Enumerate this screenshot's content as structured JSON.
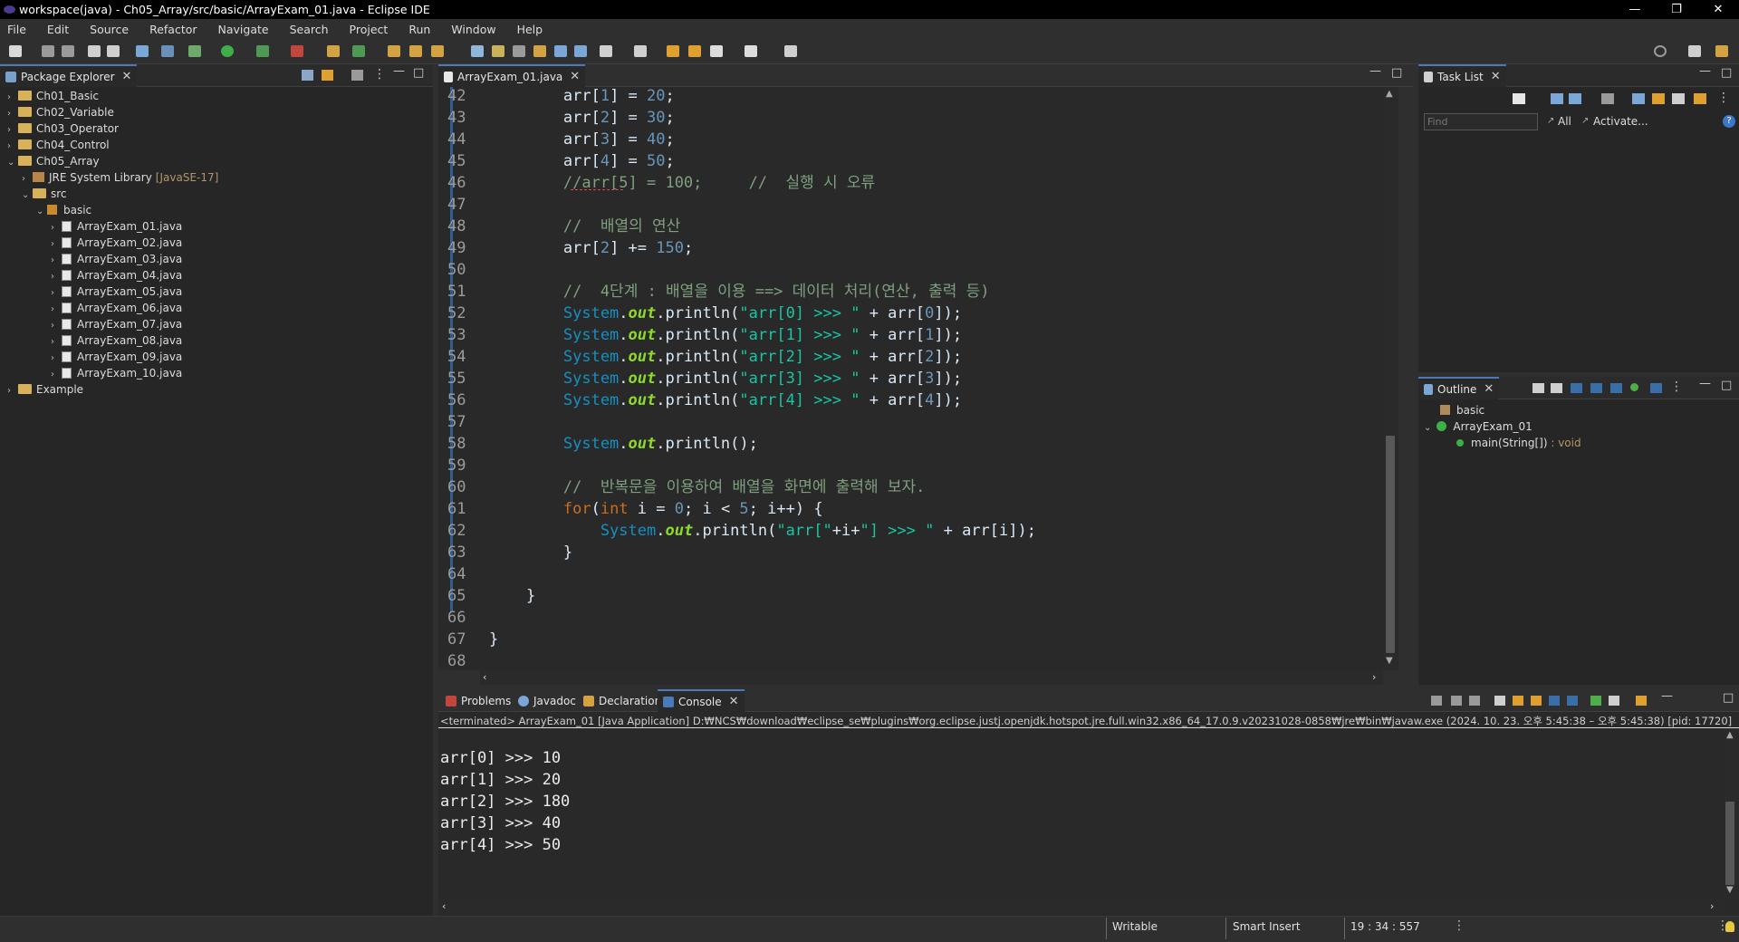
{
  "window": {
    "title": "workspace(java) - Ch05_Array/src/basic/ArrayExam_01.java - Eclipse IDE",
    "controls": [
      "—",
      "❐",
      "✕"
    ]
  },
  "menu": [
    "File",
    "Edit",
    "Source",
    "Refactor",
    "Navigate",
    "Search",
    "Project",
    "Run",
    "Window",
    "Help"
  ],
  "package_explorer": {
    "tab": "Package Explorer",
    "items": [
      {
        "label": "Ch01_Basic",
        "depth": 0,
        "type": "project",
        "chev": "›"
      },
      {
        "label": "Ch02_Variable",
        "depth": 0,
        "type": "project",
        "chev": "›"
      },
      {
        "label": "Ch03_Operator",
        "depth": 0,
        "type": "project",
        "chev": "›"
      },
      {
        "label": "Ch04_Control",
        "depth": 0,
        "type": "project",
        "chev": "›"
      },
      {
        "label": "Ch05_Array",
        "depth": 0,
        "type": "project",
        "chev": "⌄"
      },
      {
        "label": "JRE System Library",
        "suffix": "[JavaSE-17]",
        "depth": 1,
        "type": "lib",
        "chev": "›"
      },
      {
        "label": "src",
        "depth": 1,
        "type": "folder",
        "chev": "⌄"
      },
      {
        "label": "basic",
        "depth": 2,
        "type": "package",
        "chev": "⌄"
      },
      {
        "label": "ArrayExam_01.java",
        "depth": 3,
        "type": "file",
        "chev": "›"
      },
      {
        "label": "ArrayExam_02.java",
        "depth": 3,
        "type": "file",
        "chev": "›"
      },
      {
        "label": "ArrayExam_03.java",
        "depth": 3,
        "type": "file",
        "chev": "›"
      },
      {
        "label": "ArrayExam_04.java",
        "depth": 3,
        "type": "file",
        "chev": "›"
      },
      {
        "label": "ArrayExam_05.java",
        "depth": 3,
        "type": "file",
        "chev": "›"
      },
      {
        "label": "ArrayExam_06.java",
        "depth": 3,
        "type": "file",
        "chev": "›"
      },
      {
        "label": "ArrayExam_07.java",
        "depth": 3,
        "type": "file",
        "chev": "›"
      },
      {
        "label": "ArrayExam_08.java",
        "depth": 3,
        "type": "file",
        "chev": "›"
      },
      {
        "label": "ArrayExam_09.java",
        "depth": 3,
        "type": "file",
        "chev": "›"
      },
      {
        "label": "ArrayExam_10.java",
        "depth": 3,
        "type": "file",
        "chev": "›"
      },
      {
        "label": "Example",
        "depth": 0,
        "type": "project",
        "chev": "›"
      }
    ]
  },
  "editor": {
    "tab": "ArrayExam_01.java",
    "lines": [
      {
        "n": "42",
        "t": [
          [
            "def",
            "        arr["
          ],
          [
            "num",
            "1"
          ],
          [
            "def",
            "] = "
          ],
          [
            "num",
            "20"
          ],
          [
            "def",
            ";"
          ]
        ]
      },
      {
        "n": "43",
        "t": [
          [
            "def",
            "        arr["
          ],
          [
            "num",
            "2"
          ],
          [
            "def",
            "] = "
          ],
          [
            "num",
            "30"
          ],
          [
            "def",
            ";"
          ]
        ]
      },
      {
        "n": "44",
        "t": [
          [
            "def",
            "        arr["
          ],
          [
            "num",
            "3"
          ],
          [
            "def",
            "] = "
          ],
          [
            "num",
            "40"
          ],
          [
            "def",
            ";"
          ]
        ]
      },
      {
        "n": "45",
        "t": [
          [
            "def",
            "        arr["
          ],
          [
            "num",
            "4"
          ],
          [
            "def",
            "] = "
          ],
          [
            "num",
            "50"
          ],
          [
            "def",
            ";"
          ]
        ]
      },
      {
        "n": "46",
        "t": [
          [
            "cmt",
            "        //arr[5] = 100;     //  실행 시 오류"
          ]
        ]
      },
      {
        "n": "47",
        "t": []
      },
      {
        "n": "48",
        "t": [
          [
            "cmt",
            "        //  배열의 연산"
          ]
        ]
      },
      {
        "n": "49",
        "t": [
          [
            "def",
            "        arr["
          ],
          [
            "num",
            "2"
          ],
          [
            "def",
            "] += "
          ],
          [
            "num",
            "150"
          ],
          [
            "def",
            ";"
          ]
        ]
      },
      {
        "n": "50",
        "t": []
      },
      {
        "n": "51",
        "t": [
          [
            "cmt",
            "        //  4단계 : 배열을 이용 ==> 데이터 처리(연산, 출력 등)"
          ]
        ]
      },
      {
        "n": "52",
        "t": [
          [
            "cls",
            "        System"
          ],
          [
            "def",
            "."
          ],
          [
            "fld",
            "out"
          ],
          [
            "def",
            ".println("
          ],
          [
            "str",
            "\"arr[0] >>> \""
          ],
          [
            "def",
            " + arr["
          ],
          [
            "num",
            "0"
          ],
          [
            "def",
            "]);"
          ]
        ]
      },
      {
        "n": "53",
        "t": [
          [
            "cls",
            "        System"
          ],
          [
            "def",
            "."
          ],
          [
            "fld",
            "out"
          ],
          [
            "def",
            ".println("
          ],
          [
            "str",
            "\"arr[1] >>> \""
          ],
          [
            "def",
            " + arr["
          ],
          [
            "num",
            "1"
          ],
          [
            "def",
            "]);"
          ]
        ]
      },
      {
        "n": "54",
        "t": [
          [
            "cls",
            "        System"
          ],
          [
            "def",
            "."
          ],
          [
            "fld",
            "out"
          ],
          [
            "def",
            ".println("
          ],
          [
            "str",
            "\"arr[2] >>> \""
          ],
          [
            "def",
            " + arr["
          ],
          [
            "num",
            "2"
          ],
          [
            "def",
            "]);"
          ]
        ]
      },
      {
        "n": "55",
        "t": [
          [
            "cls",
            "        System"
          ],
          [
            "def",
            "."
          ],
          [
            "fld",
            "out"
          ],
          [
            "def",
            ".println("
          ],
          [
            "str",
            "\"arr[3] >>> \""
          ],
          [
            "def",
            " + arr["
          ],
          [
            "num",
            "3"
          ],
          [
            "def",
            "]);"
          ]
        ]
      },
      {
        "n": "56",
        "t": [
          [
            "cls",
            "        System"
          ],
          [
            "def",
            "."
          ],
          [
            "fld",
            "out"
          ],
          [
            "def",
            ".println("
          ],
          [
            "str",
            "\"arr[4] >>> \""
          ],
          [
            "def",
            " + arr["
          ],
          [
            "num",
            "4"
          ],
          [
            "def",
            "]);"
          ]
        ]
      },
      {
        "n": "57",
        "t": []
      },
      {
        "n": "58",
        "t": [
          [
            "cls",
            "        System"
          ],
          [
            "def",
            "."
          ],
          [
            "fld",
            "out"
          ],
          [
            "def",
            ".println();"
          ]
        ]
      },
      {
        "n": "59",
        "t": []
      },
      {
        "n": "60",
        "t": [
          [
            "cmt",
            "        //  반복문을 이용하여 배열을 화면에 출력해 보자."
          ]
        ]
      },
      {
        "n": "61",
        "t": [
          [
            "kw",
            "        for"
          ],
          [
            "def",
            "("
          ],
          [
            "kw",
            "int"
          ],
          [
            "def",
            " i = "
          ],
          [
            "num",
            "0"
          ],
          [
            "def",
            "; i < "
          ],
          [
            "num",
            "5"
          ],
          [
            "def",
            "; i++) {"
          ]
        ]
      },
      {
        "n": "62",
        "t": [
          [
            "cls",
            "            System"
          ],
          [
            "def",
            "."
          ],
          [
            "fld",
            "out"
          ],
          [
            "def",
            ".println("
          ],
          [
            "str",
            "\"arr[\""
          ],
          [
            "def",
            "+i+"
          ],
          [
            "str",
            "\"] >>> \""
          ],
          [
            "def",
            " + arr[i]);"
          ]
        ]
      },
      {
        "n": "63",
        "t": [
          [
            "def",
            "        }"
          ]
        ]
      },
      {
        "n": "64",
        "t": []
      },
      {
        "n": "65",
        "t": [
          [
            "def",
            "    }"
          ]
        ]
      },
      {
        "n": "66",
        "t": []
      },
      {
        "n": "67",
        "t": [
          [
            "def",
            "}"
          ]
        ]
      },
      {
        "n": "68",
        "t": []
      }
    ]
  },
  "task_list": {
    "tab": "Task List",
    "find_placeholder": "Find",
    "all": "All",
    "activate": "Activate..."
  },
  "outline": {
    "tab": "Outline",
    "package": "basic",
    "class": "ArrayExam_01",
    "method": "main(String[])",
    "method_type": " : void"
  },
  "bottom_tabs": [
    "Problems",
    "Javadoc",
    "Declaration",
    "Console"
  ],
  "console": {
    "header": "<terminated> ArrayExam_01 [Java Application] D:₩NCS₩download₩eclipse_se₩plugins₩org.eclipse.justj.openjdk.hotspot.jre.full.win32.x86_64_17.0.9.v20231028-0858₩jre₩bin₩javaw.exe  (2024. 10. 23. 오후 5:45:38 – 오후 5:45:38) [pid: 17720]",
    "output": [
      "arr[0] >>> 10",
      "arr[1] >>> 20",
      "arr[2] >>> 180",
      "arr[3] >>> 40",
      "arr[4] >>> 50"
    ]
  },
  "status": {
    "writable": "Writable",
    "insert": "Smart Insert",
    "position": "19 : 34 : 557"
  },
  "colors": {
    "keyword": "#cc6c1d",
    "number": "#6897bb",
    "string": "#17c6a3",
    "comment": "#7f9f7f",
    "class": "#1290c3",
    "field": "#8dda2b"
  }
}
